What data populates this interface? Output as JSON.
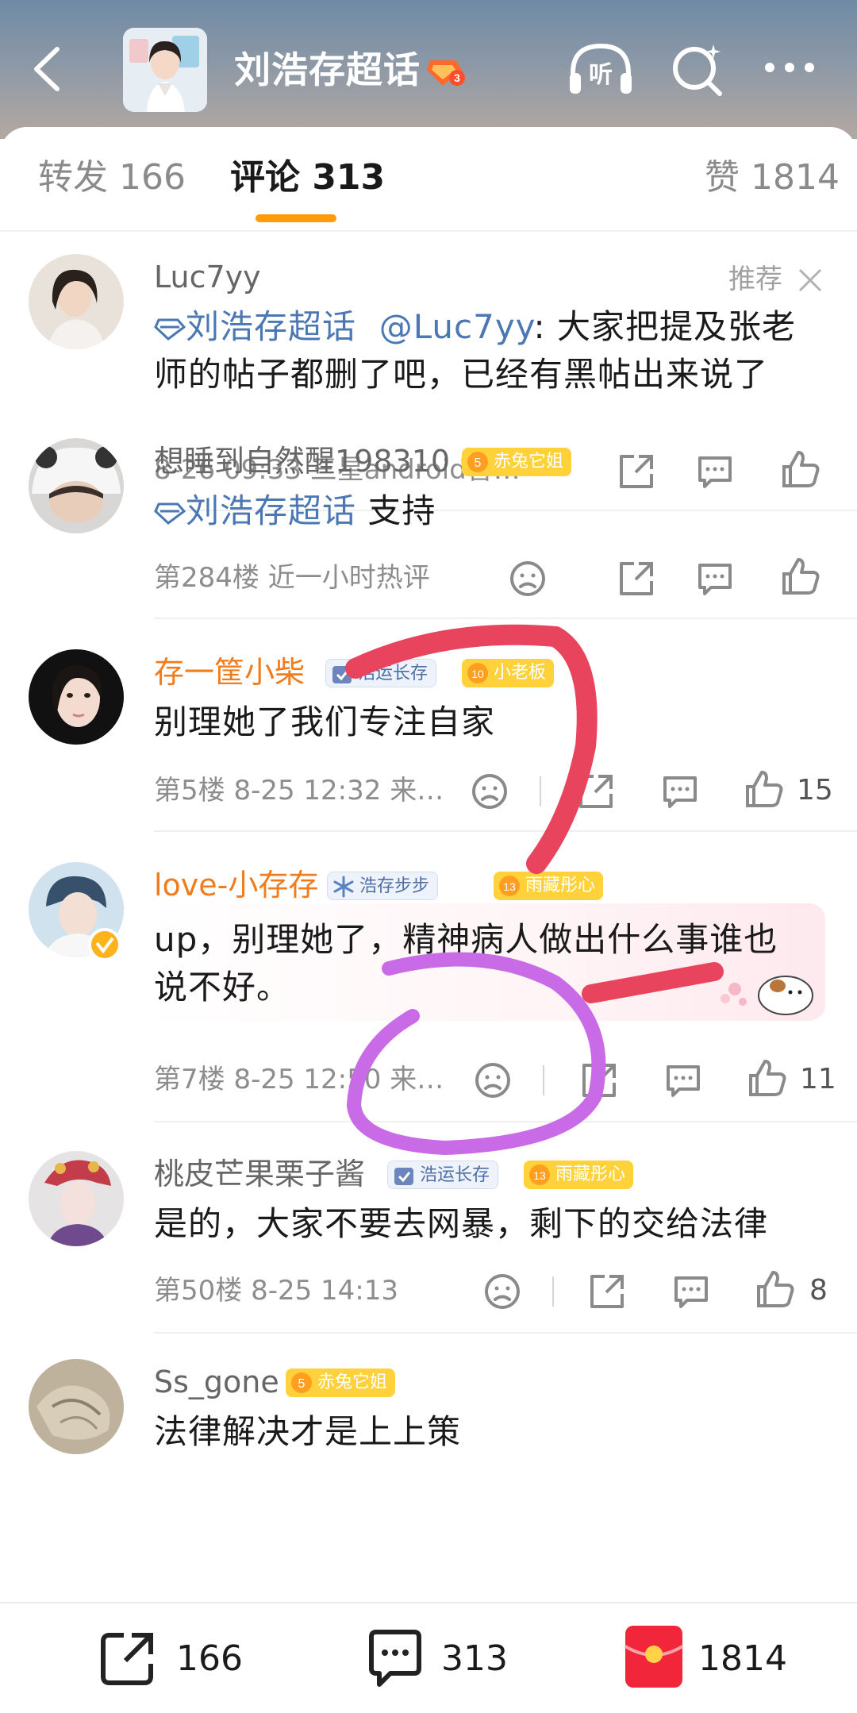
{
  "header": {
    "topic_title": "刘浩存超话",
    "level": "3",
    "listen_label": "听"
  },
  "tabs": [
    {
      "label": "转发 166"
    },
    {
      "label": "评论 313"
    },
    {
      "label": "赞 1814"
    }
  ],
  "pinned_label": "推荐",
  "comments": [
    {
      "username": "Luc7yy",
      "link": "刘浩存超话",
      "text": "@Luc7yy: 大家把提及张老师的帖子都删了吧，已经有黑帖出来说了",
      "meta": "8-26 09:33  三星android智…",
      "likes": ""
    },
    {
      "username": "想睡到自然醒198310",
      "badge_fan": {
        "level": "5",
        "label": "赤兔它姐"
      },
      "link": "刘浩存超话",
      "text": "支持",
      "meta": "第284楼  近一小时热评",
      "likes": ""
    },
    {
      "username": "存一筐小柴",
      "badge_member": "浩运长存",
      "badge_fan": {
        "level": "10",
        "label": "小老板"
      },
      "text": "别理她了我们专注自家",
      "meta": "第5楼  8-25 12:32  来…",
      "likes": "15"
    },
    {
      "username": "love-小存存",
      "badge_member": "浩存步步",
      "badge_fan": {
        "level": "13",
        "label": "雨藏彤心"
      },
      "text": "up，别理她了，精神病人做出什么事谁也说不好。",
      "meta": "第7楼  8-25 12:50  来…",
      "likes": "11"
    },
    {
      "username": "桃皮芒果栗子酱",
      "badge_member": "浩运长存",
      "badge_fan": {
        "level": "13",
        "label": "雨藏彤心"
      },
      "text": "是的，大家不要去网暴，剩下的交给法律",
      "meta": "第50楼  8-25 14:13",
      "likes": "8"
    },
    {
      "username": "Ss_gone",
      "badge_fan": {
        "level": "5",
        "label": "赤兔它姐"
      },
      "text": "法律解决才是上上策",
      "meta": "",
      "likes": ""
    }
  ],
  "bottom_bar": {
    "reposts": "166",
    "comments": "313",
    "likes": "1814"
  },
  "colors": {
    "accent_orange": "#ff9a0b",
    "link_blue": "#4b78b5",
    "annotation_red": "#e8445d",
    "annotation_purple": "#c96ae6"
  }
}
